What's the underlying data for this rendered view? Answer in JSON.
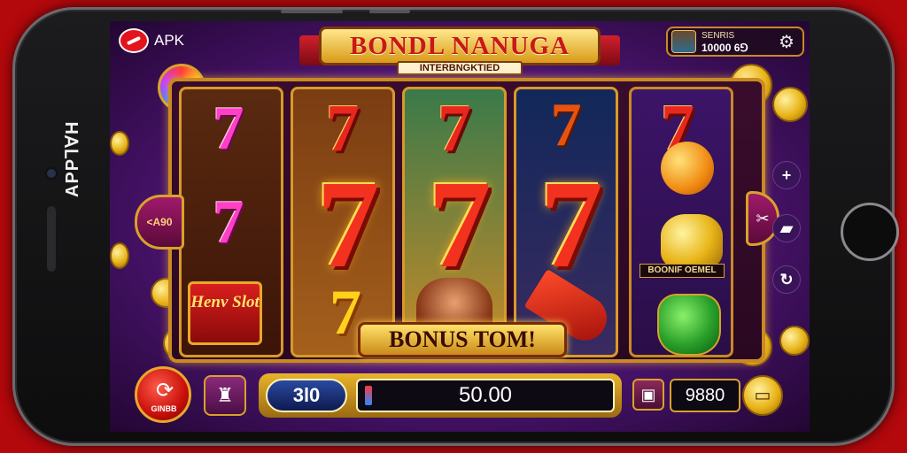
{
  "device": {
    "side_text": "APP⅂∀H"
  },
  "top_bar": {
    "apk_label": "APK",
    "banner_title": "BONDL NANUGA",
    "banner_subtitle": "INTERBNGKTIED",
    "profile_name": "SENRIS",
    "profile_coins": "10000 6⅁"
  },
  "reels": {
    "reel_0": [
      "7",
      "7"
    ],
    "reel_1": [
      "7",
      "7"
    ],
    "reel_2": [
      "7"
    ],
    "reel_3": [
      "7"
    ],
    "reel_4": [
      "7"
    ],
    "win_line": [
      "7",
      "7",
      "7"
    ],
    "bottom_symbol": "7",
    "heavy_slot_label": "Henv Slot",
    "bonus_tag": "BOONIF OEMEL"
  },
  "bonus_banner": "BONUS TOM!",
  "left_arrow_label": "<A90",
  "buttons": {
    "spin_label": "GINBB",
    "plus_label": "+"
  },
  "bottom_bar": {
    "bet_value": "3l0",
    "win_value": "50.00",
    "balance_value": "9880"
  },
  "icons": [
    "apk-logo-icon",
    "gear-icon",
    "plus-icon",
    "scissors-icon",
    "speech-icon",
    "refresh-icon",
    "spin-icon",
    "robot-icon",
    "cash-icon",
    "menu-icon"
  ],
  "colors": {
    "background": "#b3080c",
    "screen": "#4b1470",
    "gold": "#c98a22",
    "seven_red": "#e8281c",
    "seven_pink": "#ff3fc6"
  }
}
